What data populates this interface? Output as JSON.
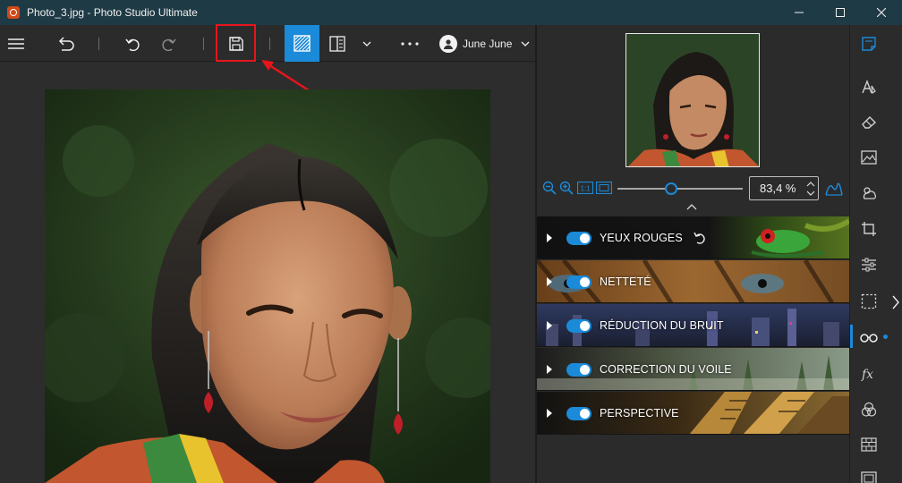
{
  "window": {
    "title": "Photo_3.jpg - Photo Studio Ultimate",
    "controls": [
      "minimize-icon",
      "maximize-icon",
      "close-icon"
    ]
  },
  "toolbar": {
    "menu_icon": "hamburger-icon",
    "history_icon": "history-undo-icon",
    "undo_icon": "undo-icon",
    "redo_icon": "redo-icon",
    "save_icon": "floppy-disk-icon",
    "view_single_icon": "single-view-icon",
    "view_compare_icon": "compare-view-icon",
    "more_icon": "ellipsis-icon",
    "user_name": "June June"
  },
  "panel": {
    "zoom_value": "83,4 %",
    "zoom_level": 0.42,
    "effects": [
      {
        "label": "YEUX ROUGES",
        "enabled": true,
        "has_reset": true
      },
      {
        "label": "NETTETÉ",
        "enabled": true,
        "has_reset": false
      },
      {
        "label": "RÉDUCTION DU BRUIT",
        "enabled": true,
        "has_reset": false
      },
      {
        "label": "CORRECTION DU VOILE",
        "enabled": true,
        "has_reset": false
      },
      {
        "label": "PERSPECTIVE",
        "enabled": true,
        "has_reset": false
      }
    ]
  },
  "colors": {
    "titlebar": "#1e3a45",
    "accent": "#1b8ad8",
    "highlight": "#e8141b",
    "background": "#2b2b2b"
  },
  "sidebar": {
    "icons": [
      "edit-icon",
      "text-style-icon",
      "eraser-icon",
      "landscape-icon",
      "weather-icon",
      "crop-icon",
      "sliders-icon",
      "selection-icon",
      "glasses-icon",
      "fx-icon",
      "color-circles-icon",
      "texture-icon",
      "frame-icon"
    ],
    "active": "glasses-icon"
  }
}
